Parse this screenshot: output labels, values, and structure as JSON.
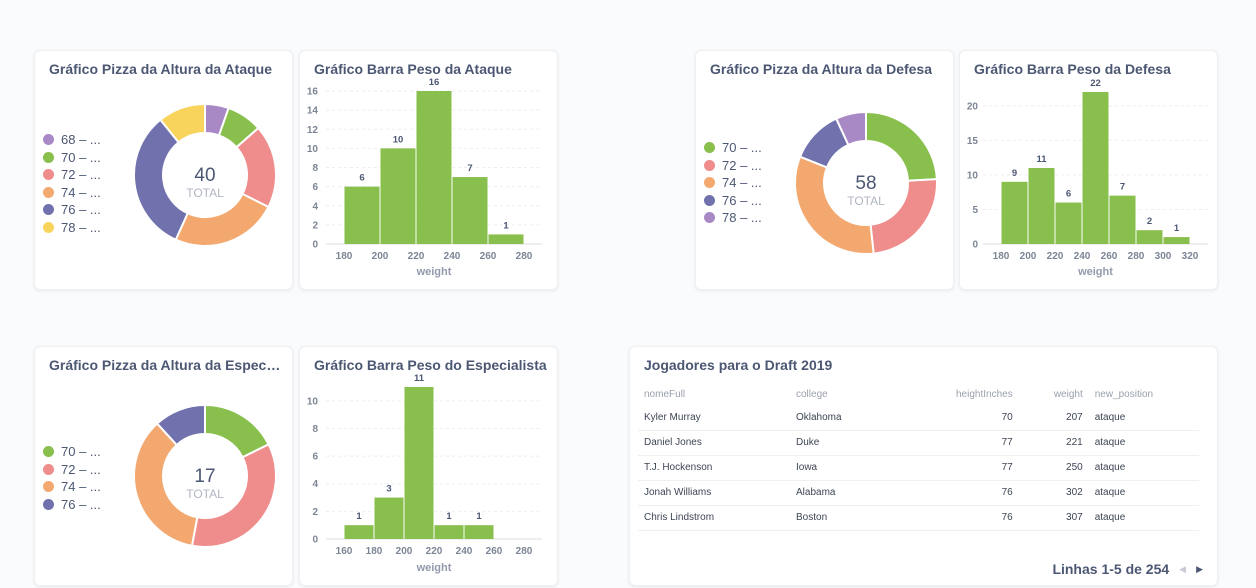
{
  "cards": {
    "pie_ataque": {
      "title": "Gráfico Pizza da Altura da Ataque",
      "total": "40",
      "total_label": "TOTAL"
    },
    "bar_ataque": {
      "title": "Gráfico Barra Peso da Ataque"
    },
    "pie_defesa": {
      "title": "Gráfico Pizza da Altura da Defesa",
      "total": "58",
      "total_label": "TOTAL"
    },
    "bar_defesa": {
      "title": "Gráfico Barra Peso da Defesa"
    },
    "pie_especialista": {
      "title": "Gráfico Pizza da Altura da Especiali...",
      "total": "17",
      "total_label": "TOTAL"
    },
    "bar_especialista": {
      "title": "Gráfico Barra Peso do Especialista"
    },
    "table": {
      "title": "Jogadores para o Draft 2019",
      "columns": [
        "nomeFull",
        "college",
        "heightInches",
        "weight",
        "new_position"
      ],
      "rows": [
        [
          "Kyler Murray",
          "Oklahoma",
          "70",
          "207",
          "ataque"
        ],
        [
          "Daniel Jones",
          "Duke",
          "77",
          "221",
          "ataque"
        ],
        [
          "T.J. Hockenson",
          "Iowa",
          "77",
          "250",
          "ataque"
        ],
        [
          "Jonah Williams",
          "Alabama",
          "76",
          "302",
          "ataque"
        ],
        [
          "Chris Lindstrom",
          "Boston",
          "76",
          "307",
          "ataque"
        ]
      ],
      "pagination": "Linhas 1-5 de 254"
    }
  },
  "chart_data": [
    {
      "id": "pie_ataque",
      "type": "pie",
      "title": "Gráfico Pizza da Altura da Ataque",
      "categories": [
        "68 – ...",
        "70 – ...",
        "72 – ...",
        "74 – ...",
        "76 – ...",
        "78 – ..."
      ],
      "values": [
        2,
        3,
        7,
        9,
        12,
        4
      ],
      "colors": [
        "#a989c5",
        "#88bf4d",
        "#ef8c8c",
        "#f2a86f",
        "#7172ad",
        "#f9d45c"
      ],
      "total": 40
    },
    {
      "id": "bar_ataque",
      "type": "bar",
      "title": "Gráfico Barra Peso da Ataque",
      "xlabel": "weight",
      "bins": [
        [
          180,
          200
        ],
        [
          200,
          220
        ],
        [
          220,
          240
        ],
        [
          240,
          260
        ],
        [
          260,
          280
        ]
      ],
      "values": [
        6,
        10,
        16,
        7,
        1
      ],
      "xticks": [
        180,
        200,
        220,
        240,
        260,
        280
      ],
      "yticks": [
        0,
        2,
        4,
        6,
        8,
        10,
        12,
        14,
        16
      ],
      "ylim": [
        0,
        16
      ],
      "color": "#88bf4d"
    },
    {
      "id": "pie_defesa",
      "type": "pie",
      "title": "Gráfico Pizza da Altura da Defesa",
      "categories": [
        "70 – ...",
        "72 – ...",
        "74 – ...",
        "76 – ...",
        "78 – ..."
      ],
      "values": [
        14,
        14,
        19,
        7,
        4
      ],
      "colors": [
        "#88bf4d",
        "#ef8c8c",
        "#f2a86f",
        "#7172ad",
        "#a989c5"
      ],
      "total": 58
    },
    {
      "id": "bar_defesa",
      "type": "bar",
      "title": "Gráfico Barra Peso da Defesa",
      "xlabel": "weight",
      "bins": [
        [
          180,
          200
        ],
        [
          200,
          220
        ],
        [
          220,
          240
        ],
        [
          240,
          260
        ],
        [
          260,
          280
        ],
        [
          280,
          300
        ],
        [
          300,
          320
        ]
      ],
      "values": [
        9,
        11,
        6,
        22,
        7,
        2,
        1
      ],
      "xticks": [
        180,
        200,
        220,
        240,
        260,
        280,
        300,
        320
      ],
      "yticks": [
        0,
        5,
        10,
        15,
        20
      ],
      "ylim": [
        0,
        22
      ],
      "color": "#88bf4d"
    },
    {
      "id": "pie_especialista",
      "type": "pie",
      "title": "Gráfico Pizza da Altura da Especiali...",
      "categories": [
        "70 – ...",
        "72 – ...",
        "74 – ...",
        "76 – ..."
      ],
      "values": [
        3,
        6,
        6,
        2
      ],
      "colors": [
        "#88bf4d",
        "#ef8c8c",
        "#f2a86f",
        "#7172ad"
      ],
      "total": 17
    },
    {
      "id": "bar_especialista",
      "type": "bar",
      "title": "Gráfico Barra Peso do Especialista",
      "xlabel": "weight",
      "bins": [
        [
          160,
          180
        ],
        [
          180,
          200
        ],
        [
          200,
          220
        ],
        [
          220,
          240
        ],
        [
          240,
          260
        ]
      ],
      "values": [
        1,
        3,
        11,
        1,
        1
      ],
      "xticks": [
        160,
        180,
        200,
        220,
        240,
        260,
        280
      ],
      "yticks": [
        0,
        2,
        4,
        6,
        8,
        10
      ],
      "ylim": [
        0,
        11
      ],
      "color": "#88bf4d"
    }
  ]
}
